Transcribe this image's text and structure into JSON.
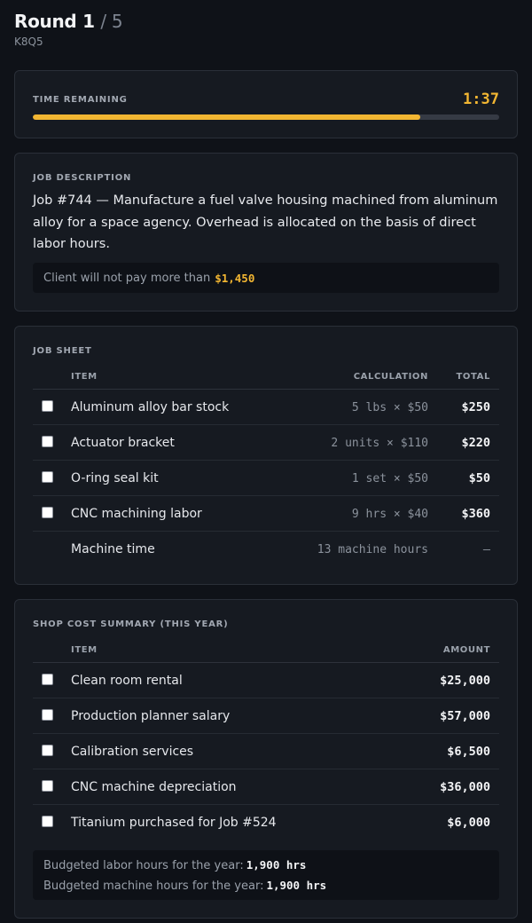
{
  "header": {
    "round_label": "Round 1",
    "round_of": "/ 5",
    "code": "K8Q5"
  },
  "timer": {
    "label": "TIME REMAINING",
    "value": "1:37",
    "progress_fraction": 0.83,
    "accent_color": "#f2b632"
  },
  "job": {
    "label": "JOB DESCRIPTION",
    "text": "Job #744 — Manufacture a fuel valve housing machined from aluminum alloy for a space agency. Overhead is allocated on the basis of direct labor hours.",
    "budget_prefix": "Client will not pay more than",
    "budget_amount": "$1,450"
  },
  "job_sheet": {
    "label": "JOB SHEET",
    "columns": {
      "item": "ITEM",
      "calc": "CALCULATION",
      "total": "TOTAL"
    },
    "rows": [
      {
        "item": "Aluminum alloy bar stock",
        "calc": "5 lbs × $50",
        "total": "$250",
        "checkbox": true
      },
      {
        "item": "Actuator bracket",
        "calc": "2 units × $110",
        "total": "$220",
        "checkbox": true
      },
      {
        "item": "O-ring seal kit",
        "calc": "1 set × $50",
        "total": "$50",
        "checkbox": true
      },
      {
        "item": "CNC machining labor",
        "calc": "9 hrs × $40",
        "total": "$360",
        "checkbox": true
      },
      {
        "item": "Machine time",
        "calc": "13 machine hours",
        "total": "—",
        "checkbox": false
      }
    ]
  },
  "shop_summary": {
    "label": "SHOP COST SUMMARY (THIS YEAR)",
    "columns": {
      "item": "ITEM",
      "amount": "AMOUNT"
    },
    "rows": [
      {
        "item": "Clean room rental",
        "amount": "$25,000"
      },
      {
        "item": "Production planner salary",
        "amount": "$57,000"
      },
      {
        "item": "Calibration services",
        "amount": "$6,500"
      },
      {
        "item": "CNC machine depreciation",
        "amount": "$36,000"
      },
      {
        "item": "Titanium purchased for Job #524",
        "amount": "$6,000"
      }
    ],
    "notes": {
      "labor_label": "Budgeted labor hours for the year:",
      "labor_value": "1,900 hrs",
      "machine_label": "Budgeted machine hours for the year:",
      "machine_value": "1,900 hrs"
    }
  }
}
